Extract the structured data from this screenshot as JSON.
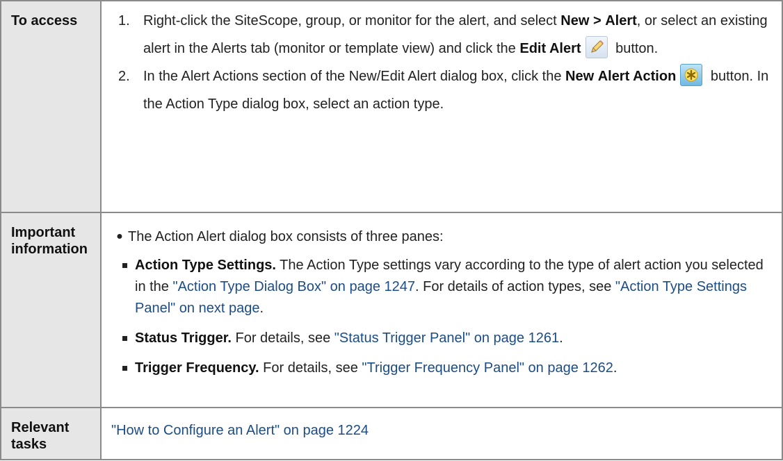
{
  "rows": {
    "access": {
      "header": "To access",
      "step1": {
        "num": "1.",
        "a": "Right-click the SiteScope, group, or monitor for the alert, and select ",
        "b1": "New >",
        "b2": "Alert",
        "c": ", or select an existing alert in the Alerts tab (monitor or template view) and click the ",
        "b3": "Edit Alert",
        "d": " button.",
        "icon": "pencil-edit-icon"
      },
      "step2": {
        "num": "2.",
        "a": "In the Alert Actions section of the New/Edit Alert dialog box, click the ",
        "b1": "New",
        "b2": "Alert Action",
        "c": " button. In the Action Type dialog box, select an action type.",
        "icon": "new-asterisk-icon"
      }
    },
    "important": {
      "header_line1": "Important",
      "header_line2": "information",
      "bullet": "The Action Alert dialog box consists of three panes:",
      "items": [
        {
          "bold": "Action Type Settings.",
          "text1": " The Action Type settings vary according to the type of alert action you selected in the ",
          "link1": "\"Action Type Dialog Box\" on page 1247",
          "text2": ". For details of action types, see ",
          "link2": "\"Action Type Settings Panel\" on next page",
          "text3": "."
        },
        {
          "bold": "Status Trigger.",
          "text1": " For details, see ",
          "link1": "\"Status Trigger Panel\" on page 1261",
          "text2": "."
        },
        {
          "bold": "Trigger Frequency.",
          "text1": " For details, see ",
          "link1": "\"Trigger Frequency Panel\" on page 1262",
          "text2": "."
        }
      ]
    },
    "tasks": {
      "header_line1": "Relevant",
      "header_line2": "tasks",
      "link": "\"How to Configure an Alert\" on page 1224"
    }
  },
  "colors": {
    "header_bg": "#e6e6e6",
    "border": "#8a8a8a",
    "link": "#1c4c86"
  }
}
